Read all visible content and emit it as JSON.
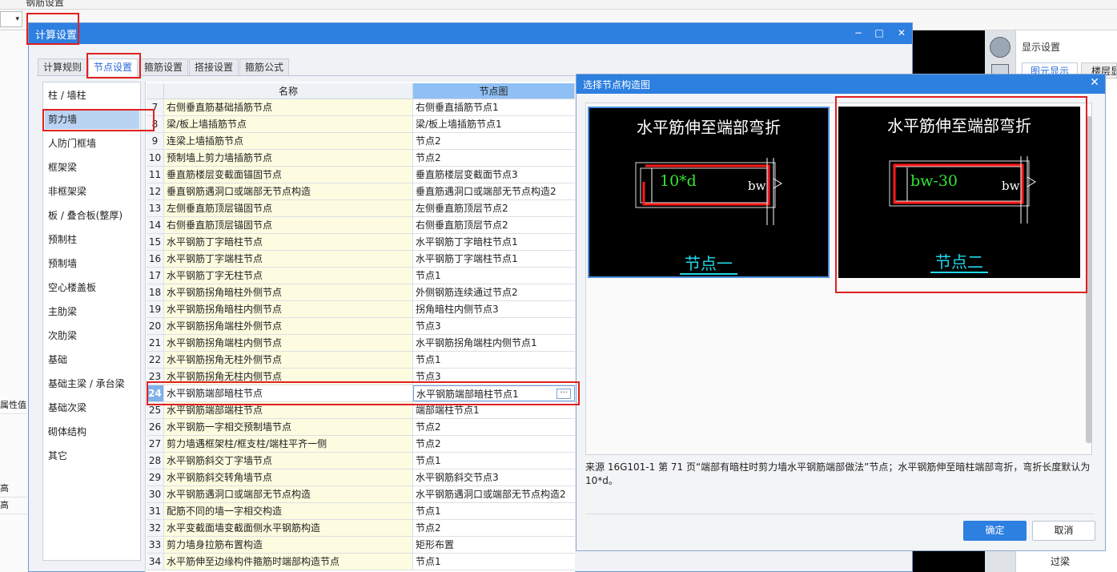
{
  "background_app": {
    "top_title": "钢筋设置",
    "right_panel_title": "显示设置",
    "right_tab_1": "图元显示",
    "right_tab_2": "楼层显",
    "left_labels": [
      "属性值",
      "高",
      "高"
    ],
    "bottom_right_item": "过梁"
  },
  "dialog": {
    "title": "计算设置",
    "minimize": "−",
    "maximize": "□",
    "close": "✕",
    "tabs": [
      "计算规则",
      "节点设置",
      "箍筋设置",
      "搭接设置",
      "箍筋公式"
    ],
    "active_tab_index": 1,
    "categories": [
      "柱 / 墙柱",
      "剪力墙",
      "人防门框墙",
      "框架梁",
      "非框架梁",
      "板 / 叠合板(整厚)",
      "预制柱",
      "预制墙",
      "空心楼盖板",
      "主肋梁",
      "次肋梁",
      "基础",
      "基础主梁 / 承台梁",
      "基础次梁",
      "砌体结构",
      "其它"
    ],
    "selected_category_index": 1,
    "grid": {
      "header_name": "名称",
      "header_node": "节点图",
      "rows": [
        {
          "num": "7",
          "name": "右侧垂直筋基础插筋节点",
          "node": "右侧垂直插筋节点1"
        },
        {
          "num": "8",
          "name": "梁/板上墙插筋节点",
          "node": "梁/板上墙插筋节点1"
        },
        {
          "num": "9",
          "name": "连梁上墙插筋节点",
          "node": "节点2"
        },
        {
          "num": "10",
          "name": "预制墙上剪力墙插筋节点",
          "node": "节点2"
        },
        {
          "num": "11",
          "name": "垂直筋楼层变截面锚固节点",
          "node": "垂直筋楼层变截面节点3"
        },
        {
          "num": "12",
          "name": "垂直钢筋遇洞口或端部无节点构造",
          "node": "垂直筋遇洞口或端部无节点构造2"
        },
        {
          "num": "13",
          "name": "左侧垂直筋顶层锚固节点",
          "node": "左侧垂直筋顶层节点2"
        },
        {
          "num": "14",
          "name": "右侧垂直筋顶层锚固节点",
          "node": "右侧垂直筋顶层节点2"
        },
        {
          "num": "15",
          "name": "水平钢筋丁字暗柱节点",
          "node": "水平钢筋丁字暗柱节点1"
        },
        {
          "num": "16",
          "name": "水平钢筋丁字端柱节点",
          "node": "水平钢筋丁字端柱节点1"
        },
        {
          "num": "17",
          "name": "水平钢筋丁字无柱节点",
          "node": "节点1"
        },
        {
          "num": "18",
          "name": "水平钢筋拐角暗柱外侧节点",
          "node": "外侧钢筋连续通过节点2"
        },
        {
          "num": "19",
          "name": "水平钢筋拐角暗柱内侧节点",
          "node": "拐角暗柱内侧节点3"
        },
        {
          "num": "20",
          "name": "水平钢筋拐角端柱外侧节点",
          "node": "节点3"
        },
        {
          "num": "21",
          "name": "水平钢筋拐角端柱内侧节点",
          "node": "水平钢筋拐角端柱内侧节点1"
        },
        {
          "num": "22",
          "name": "水平钢筋拐角无柱外侧节点",
          "node": "节点1"
        },
        {
          "num": "23",
          "name": "水平钢筋拐角无柱内侧节点",
          "node": "节点3"
        },
        {
          "num": "24",
          "name": "水平钢筋端部暗柱节点",
          "node": "水平钢筋端部暗柱节点1"
        },
        {
          "num": "25",
          "name": "水平钢筋端部端柱节点",
          "node": "端部端柱节点1"
        },
        {
          "num": "26",
          "name": "水平钢筋一字相交预制墙节点",
          "node": "节点2"
        },
        {
          "num": "27",
          "name": "剪力墙遇框架柱/框支柱/端柱平齐一侧",
          "node": "节点2"
        },
        {
          "num": "28",
          "name": "水平钢筋斜交丁字墙节点",
          "node": "节点1"
        },
        {
          "num": "29",
          "name": "水平钢筋斜交转角墙节点",
          "node": "水平钢筋斜交节点3"
        },
        {
          "num": "30",
          "name": "水平钢筋遇洞口或端部无节点构造",
          "node": "水平钢筋遇洞口或端部无节点构造2"
        },
        {
          "num": "31",
          "name": "配筋不同的墙一字相交构造",
          "node": "节点1"
        },
        {
          "num": "32",
          "name": "水平变截面墙变截面侧水平钢筋构造",
          "node": "节点2"
        },
        {
          "num": "33",
          "name": "剪力墙身拉筋布置构造",
          "node": "矩形布置"
        },
        {
          "num": "34",
          "name": "水平筋伸至边缘构件箍筋时端部构造节点",
          "node": "节点1"
        }
      ],
      "selected_row_num": "24",
      "ellipsis_label": "···"
    }
  },
  "node_picker": {
    "title": "选择节点构造图",
    "close": "✕",
    "cards": [
      {
        "heading": "水平筋伸至端部弯折",
        "dim_label": "10*d",
        "bw_label": "bw",
        "caption": "节点一"
      },
      {
        "heading": "水平筋伸至端部弯折",
        "dim_label": "bw-30",
        "bw_label": "bw",
        "caption": "节点二"
      }
    ],
    "selected_card_index": 0,
    "description": "来源 16G101-1 第 71 页“端部有暗柱时剪力墙水平钢筋端部做法”节点；水平钢筋伸至暗柱端部弯折，弯折长度默认为10*d。",
    "ok_label": "确定",
    "cancel_label": "取消"
  },
  "colors": {
    "title_bar": "#2d7fe0",
    "highlight": "#e02020",
    "diagram_red": "#ff1a1a",
    "diagram_green": "#33e633",
    "caption_cyan": "#20d8e8"
  }
}
